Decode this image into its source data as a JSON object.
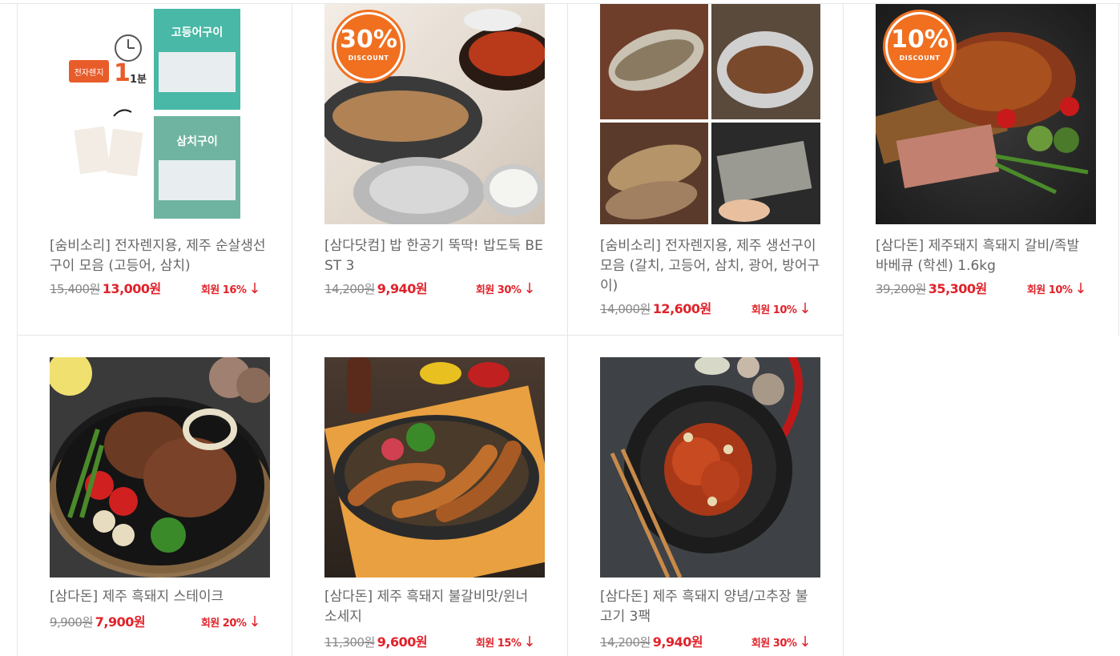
{
  "products": [
    {
      "title": "[숨비소리] 전자렌지용, 제주 순살생선구이 모음 (고등어, 삼치)",
      "original_price": "15,400원",
      "sale_price": "13,000원",
      "member_discount": "회원 16%",
      "image": "product-photo-fish-pack",
      "badge": null
    },
    {
      "title": "[삼다닷컴] 밥 한공기 뚝딱! 밥도둑 BEST 3",
      "original_price": "14,200원",
      "sale_price": "9,940원",
      "member_discount": "회원 30%",
      "image": "product-photo-grilled-fish-meal",
      "badge": {
        "percent": "30%",
        "label": "DISCOUNT"
      }
    },
    {
      "title": "[숨비소리] 전자렌지용, 제주 생선구이 모음 (갈치, 고등어, 삼치, 광어, 방어구이)",
      "original_price": "14,000원",
      "sale_price": "12,600원",
      "member_discount": "회원 10%",
      "image": "product-photo-fish-collage",
      "badge": null
    },
    {
      "title": "[삼다돈] 제주돼지 흑돼지 갈비/족발 바베큐 (학센) 1.6kg",
      "original_price": "39,200원",
      "sale_price": "35,300원",
      "member_discount": "회원 10%",
      "image": "product-photo-pork-knuckle",
      "badge": {
        "percent": "10%",
        "label": "DISCOUNT"
      }
    },
    {
      "title": "[삼다돈] 제주 흑돼지 스테이크",
      "original_price": "9,900원",
      "sale_price": "7,900원",
      "member_discount": "회원 20%",
      "image": "product-photo-steak",
      "badge": null
    },
    {
      "title": "[삼다돈] 제주 흑돼지 불갈비맛/윈너 소세지",
      "original_price": "11,300원",
      "sale_price": "9,600원",
      "member_discount": "회원 15%",
      "image": "product-photo-sausage",
      "badge": null
    },
    {
      "title": "[삼다돈] 제주 흑돼지 양념/고추장 불고기 3팩",
      "original_price": "14,200원",
      "sale_price": "9,940원",
      "member_discount": "회원 30%",
      "image": "product-photo-bulgogi",
      "badge": null
    }
  ],
  "arrow_glyph": "↓",
  "colors": {
    "sale": "#e0222a",
    "badge": "#f07020",
    "border": "#e6e6e6"
  },
  "photo_labels": {
    "microwave": "전자렌지",
    "minute": "1분",
    "pack1": "고등어구이",
    "pack2": "삼치구이"
  }
}
